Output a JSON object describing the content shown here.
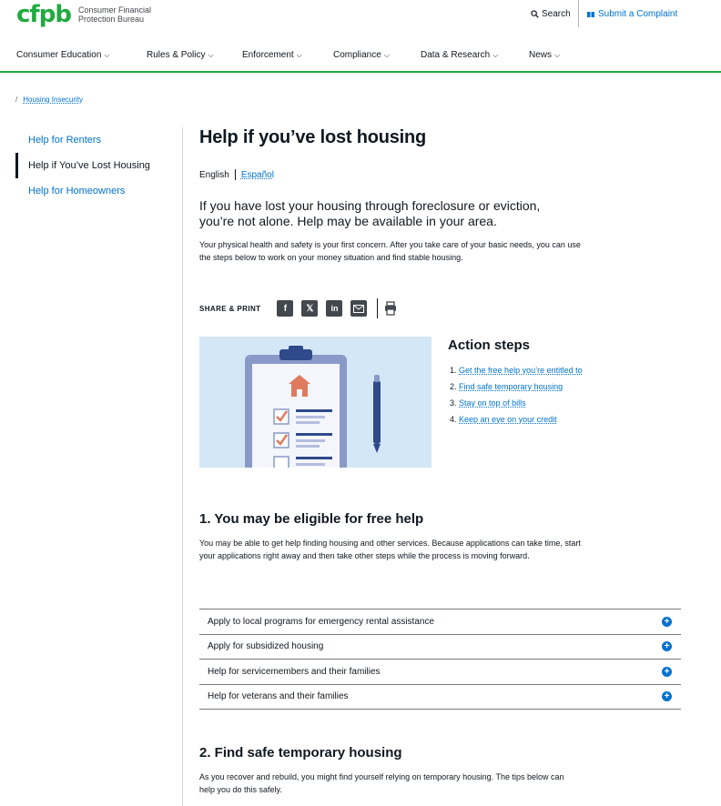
{
  "header": {
    "logo_mark": "cfpb",
    "logo_text": "Consumer Financial Protection Bureau",
    "search_label": "Search",
    "complaint_label": "Submit a Complaint"
  },
  "nav": {
    "items": [
      {
        "label": "Consumer Education"
      },
      {
        "label": "Rules & Policy"
      },
      {
        "label": "Enforcement"
      },
      {
        "label": "Compliance"
      },
      {
        "label": "Data & Research"
      },
      {
        "label": "News"
      }
    ]
  },
  "breadcrumb": {
    "separator": "/",
    "label": "Housing Insecurity"
  },
  "sidebar": {
    "items": [
      {
        "label": "Help for Renters"
      },
      {
        "label": "Help if You’ve Lost Housing"
      },
      {
        "label": "Help for Homeowners"
      }
    ],
    "active_index": 1
  },
  "main": {
    "title": "Help if you’ve lost housing",
    "lang_current": "English",
    "lang_alt": "Español",
    "lead": "If you have lost your housing through foreclosure or eviction, you’re not alone. Help may be available in your area.",
    "intro": "Your physical health and safety is your first concern. After you take care of your basic needs, you can use the steps below to work on your money situation and find stable housing.",
    "share_label": "SHARE & PRINT",
    "action_title": "Action steps",
    "action_steps": [
      {
        "num": "1.",
        "label": "Get the free help you’re entitled to"
      },
      {
        "num": "2.",
        "label": "Find safe temporary housing"
      },
      {
        "num": "3.",
        "label": "Stay on top of bills"
      },
      {
        "num": "4.",
        "label": "Keep an eye on your credit"
      }
    ],
    "section1_title": "1. You may be eligible for free help",
    "section1_text": "You may be able to get help finding housing and other services. Because applications can take time, start your applications right away and then take other steps while the process is moving forward.",
    "accordion": [
      {
        "label": "Apply to local programs for emergency rental assistance"
      },
      {
        "label": "Apply for subsidized housing"
      },
      {
        "label": "Help for servicemembers and their families"
      },
      {
        "label": "Help for veterans and their families"
      }
    ],
    "section2_title": "2. Find safe temporary housing",
    "section2_text": "As you recover and rebuild, you might find yourself relying on temporary housing. The tips below can help you do this safely."
  },
  "colors": {
    "brand_green": "#20aa3f",
    "link_blue": "#0072ce",
    "illustration_bg": "#d4e7f6"
  }
}
